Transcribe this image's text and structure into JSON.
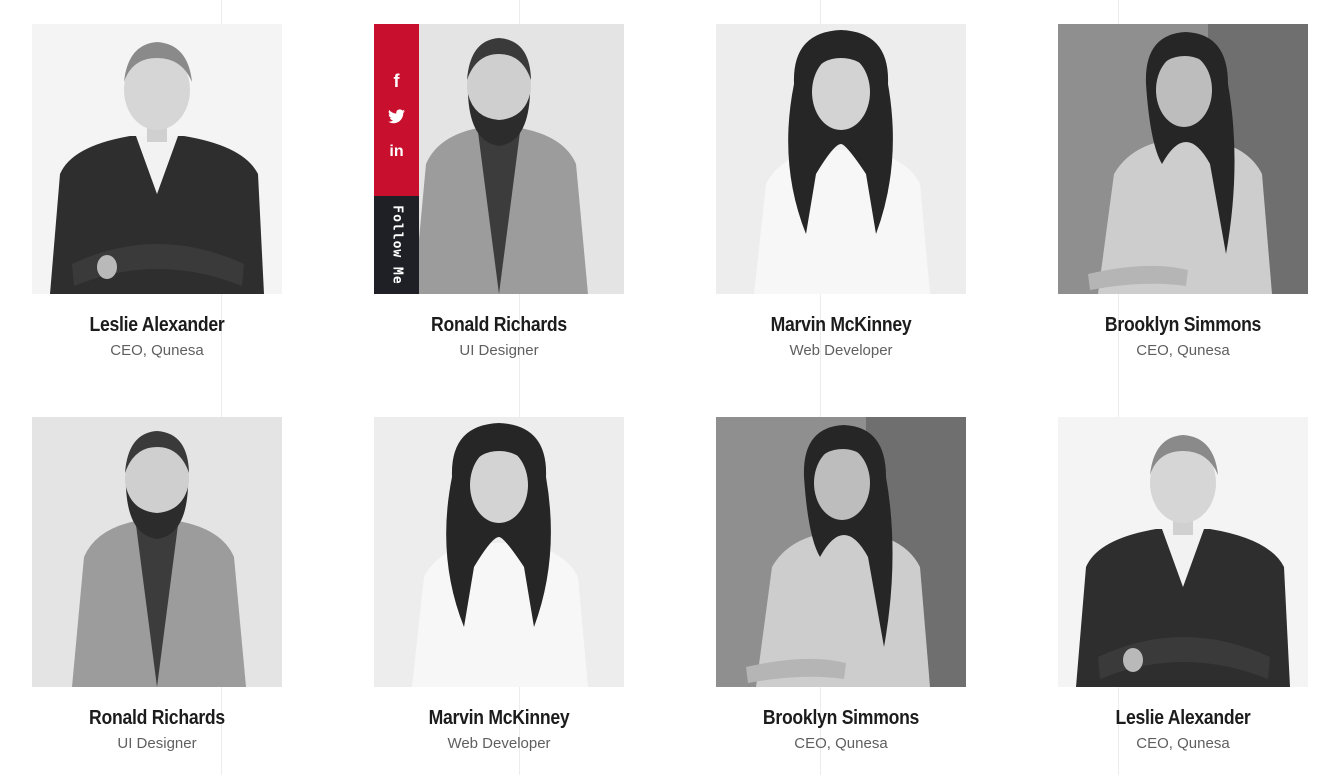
{
  "team": [
    {
      "name": "Leslie Alexander",
      "role": "CEO, Qunesa",
      "portrait": "young-man-dark-suit"
    },
    {
      "name": "Ronald Richards",
      "role": "UI Designer",
      "portrait": "bearded-man-blazer"
    },
    {
      "name": "Marvin McKinney",
      "role": "Web Developer",
      "portrait": "woman-long-curly-hair"
    },
    {
      "name": "Brooklyn Simmons",
      "role": "CEO, Qunesa",
      "portrait": "woman-grey-backdrop"
    },
    {
      "name": "Ronald Richards",
      "role": "UI Designer",
      "portrait": "bearded-man-blazer"
    },
    {
      "name": "Marvin McKinney",
      "role": "Web Developer",
      "portrait": "woman-long-curly-hair"
    },
    {
      "name": "Brooklyn Simmons",
      "role": "CEO, Qunesa",
      "portrait": "woman-grey-backdrop"
    },
    {
      "name": "Leslie Alexander",
      "role": "CEO, Qunesa",
      "portrait": "young-man-dark-suit"
    }
  ],
  "social": {
    "follow_label": "Follow Me",
    "icons": [
      "facebook-icon",
      "twitter-icon",
      "linkedin-icon"
    ],
    "facebook_glyph": "f",
    "twitter_glyph": "🐦",
    "linkedin_glyph": "in",
    "accent_color": "#c8102e",
    "follow_bg_color": "#1f2026"
  }
}
